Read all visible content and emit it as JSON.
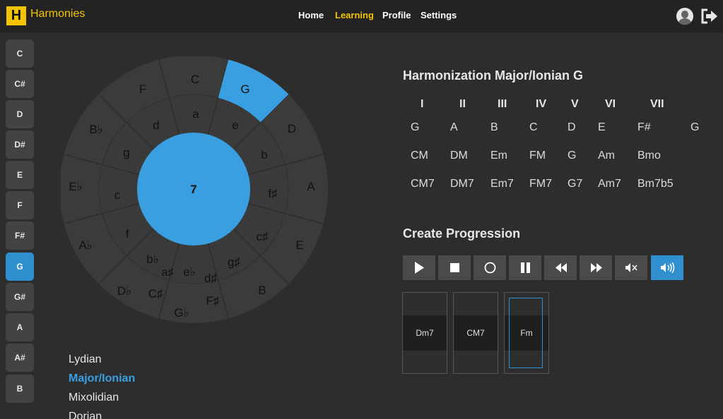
{
  "app": {
    "logo": "H",
    "name": "Harmonies"
  },
  "nav": {
    "home": "Home",
    "learning": "Learning",
    "profile": "Profile",
    "settings": "Settings"
  },
  "keys": [
    "C",
    "C#",
    "D",
    "D#",
    "E",
    "F",
    "F#",
    "G",
    "G#",
    "A",
    "A#",
    "B"
  ],
  "selected_key": "G",
  "wheel": {
    "center_label": "7",
    "outer": [
      "C",
      "G",
      "D",
      "A",
      "E",
      "B",
      "G♭",
      "D♭",
      "A♭",
      "E♭",
      "B♭",
      "F"
    ],
    "middle": [
      "a",
      "e",
      "b",
      "f♯",
      "c♯",
      "g♯",
      "d♯",
      "e♭",
      "b♭",
      "f",
      "c",
      "g",
      "d"
    ],
    "inner_extra": [
      "C♯",
      "F♯",
      "a♯"
    ],
    "highlight_color": "#3a9fe0"
  },
  "modes": [
    "Lydian",
    "Major/Ionian",
    "Mixolidian",
    "Dorian"
  ],
  "active_mode": "Major/Ionian",
  "harmonization": {
    "title": "Harmonization Major/Ionian G",
    "degrees": [
      "I",
      "II",
      "III",
      "IV",
      "V",
      "VI",
      "VII"
    ],
    "rows": [
      [
        "G",
        "A",
        "B",
        "C",
        "D",
        "E",
        "F#",
        "G"
      ],
      [
        "CM",
        "DM",
        "Em",
        "FM",
        "G",
        "Am",
        "Bmo"
      ],
      [
        "CM7",
        "DM7",
        "Em7",
        "FM7",
        "G7",
        "Am7",
        "Bm7b5"
      ]
    ]
  },
  "progression": {
    "title": "Create Progression",
    "controls": [
      "play-icon",
      "stop-icon",
      "record-icon",
      "pause-icon",
      "rewind-icon",
      "fast-forward-icon",
      "mute-icon",
      "volume-icon"
    ],
    "cards": [
      "Dm7",
      "CM7",
      "Fm"
    ]
  },
  "colors": {
    "accent": "#f5c400",
    "blue": "#2f8fcf"
  }
}
